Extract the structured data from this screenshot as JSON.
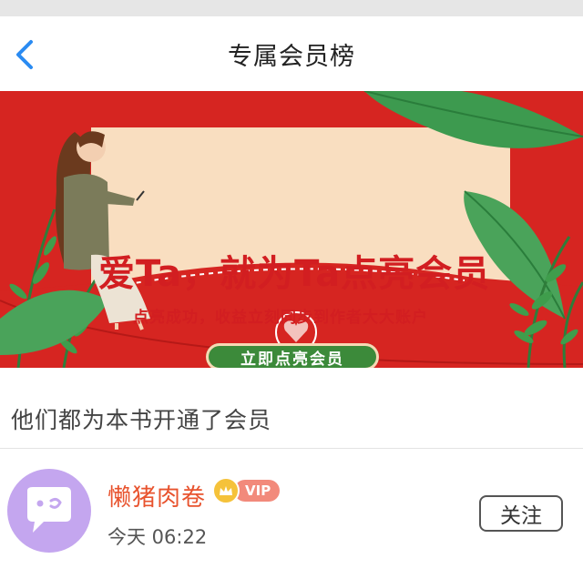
{
  "header": {
    "title": "专属会员榜"
  },
  "banner": {
    "headline": "爱Ta，就为Ta点亮会员",
    "subtitle": "点亮成功，收益立刻同步到作者大大账户",
    "cta_label": "立即点亮会员"
  },
  "section": {
    "title": "他们都为本书开通了会员"
  },
  "members": [
    {
      "name": "懒猪肉卷",
      "badge": "VIP",
      "time": "今天 06:22",
      "action_label": "关注"
    }
  ],
  "colors": {
    "banner_red": "#d62521",
    "accent_green": "#3c8a3a",
    "username": "#e8532e",
    "back_arrow": "#2a8bf2",
    "avatar": "#c4a6ef"
  }
}
